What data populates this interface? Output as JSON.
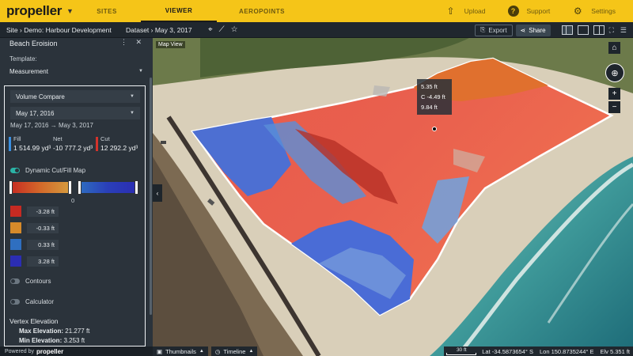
{
  "app": {
    "logo": "propeller"
  },
  "nav": {
    "sites": "SITES",
    "viewer": "VIEWER",
    "aeropoints": "AEROPOINTS"
  },
  "top_right": {
    "upload": "Upload",
    "support": "Support",
    "settings": "Settings"
  },
  "subbar": {
    "breadcrumb": "Site › Demo: Harbour Development",
    "dataset": "Dataset › May 3, 2017",
    "export": "Export",
    "share": "Share"
  },
  "sidebar": {
    "title": "Beach Eroision",
    "template_label": "Template:",
    "template_value": "Measurement",
    "volume_select": "Volume Compare",
    "date_select": "May 17, 2016",
    "date_range_from": "May 17, 2016",
    "date_range_to": "May 3, 2017",
    "fill_label": "Fill",
    "fill_value": "1 514.99 yd³",
    "net_label": "Net",
    "net_value": "-10 777.2 yd³",
    "cut_label": "Cut",
    "cut_value": "12 292.2 yd³",
    "cutfill_label": "Dynamic Cut/Fill Map",
    "zero_label": "0",
    "color_stops": [
      {
        "value": "-3.28 ft",
        "color": "#c62a22"
      },
      {
        "value": "-0.33 ft",
        "color": "#d68a2a"
      },
      {
        "value": "0.33 ft",
        "color": "#2f6fc0"
      },
      {
        "value": "3.28 ft",
        "color": "#2b2db3"
      }
    ],
    "contours_label": "Contours",
    "calculator_label": "Calculator",
    "vertex_title": "Vertex Elevation",
    "max_label": "Max Elevation:",
    "max_value": "21.277 ft",
    "min_label": "Min Elevation:",
    "min_value": "3.253 ft"
  },
  "footer": {
    "powered": "Powered by",
    "brand": "propeller"
  },
  "map": {
    "view_label": "Map View",
    "tooltip": [
      "5.35 ft",
      "C -4.49 ft",
      "9.84 ft"
    ]
  },
  "bottom": {
    "thumbnails": "Thumbnails",
    "timeline": "Timeline",
    "scale": "30 ft",
    "lat": "Lat -34.5873654° S",
    "lon": "Lon 150.8735244° E",
    "elv": "Elv 5.351 ft"
  },
  "colors": {
    "brand_yellow": "#f5c518",
    "panel_dark": "#2b333b",
    "toggle_on": "#2bb3a6"
  }
}
